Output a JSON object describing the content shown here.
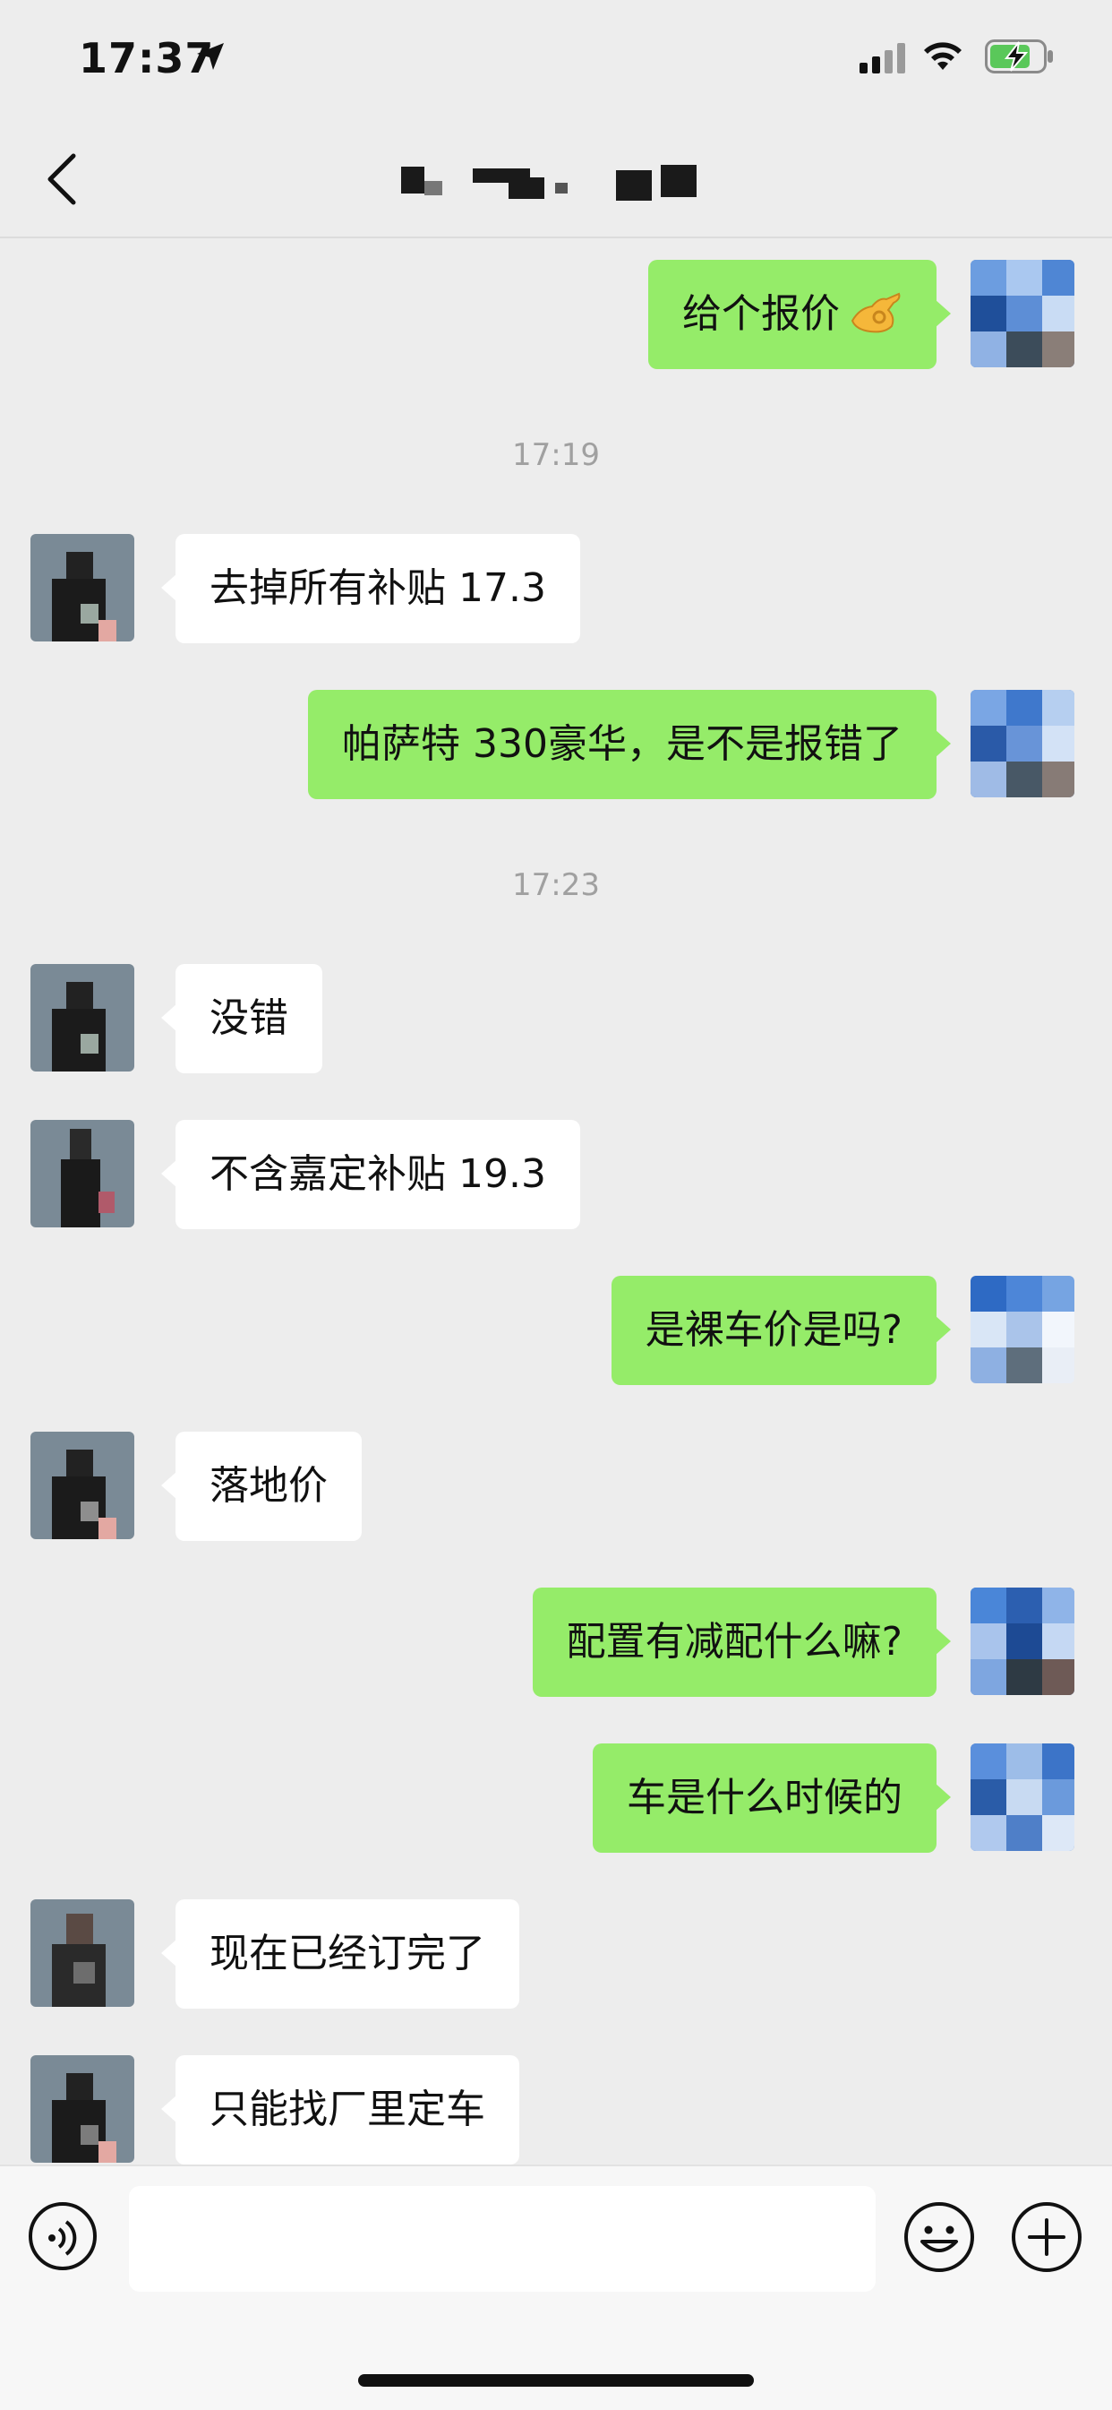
{
  "status_bar": {
    "time": "17:37"
  },
  "header": {
    "title": ""
  },
  "messages": [
    {
      "type": "msg",
      "sender": "me",
      "text": "给个报价",
      "emoji": "ok-hand-emoji"
    },
    {
      "type": "timestamp",
      "text": "17:19"
    },
    {
      "type": "msg",
      "sender": "them",
      "text": "去掉所有补贴 17.3"
    },
    {
      "type": "msg",
      "sender": "me",
      "text": "帕萨特 330豪华，是不是报错了"
    },
    {
      "type": "timestamp",
      "text": "17:23"
    },
    {
      "type": "msg",
      "sender": "them",
      "text": "没错"
    },
    {
      "type": "msg",
      "sender": "them",
      "text": "不含嘉定补贴 19.3"
    },
    {
      "type": "msg",
      "sender": "me",
      "text": "是裸车价是吗?"
    },
    {
      "type": "msg",
      "sender": "them",
      "text": "落地价"
    },
    {
      "type": "msg",
      "sender": "me",
      "text": "配置有减配什么嘛?"
    },
    {
      "type": "msg",
      "sender": "me",
      "text": "车是什么时候的"
    },
    {
      "type": "msg",
      "sender": "them",
      "text": "现在已经订完了"
    },
    {
      "type": "msg",
      "sender": "them",
      "text": "只能找厂里定车"
    }
  ],
  "input": {
    "value": "",
    "placeholder": ""
  },
  "colors": {
    "my_bubble": "#95ec69",
    "their_bubble": "#ffffff",
    "background": "#ededed"
  },
  "icons": [
    "back-chevron-icon",
    "voice-icon",
    "emoji-icon",
    "plus-icon",
    "location-arrow-icon",
    "signal-icon",
    "wifi-icon",
    "battery-charging-icon"
  ]
}
